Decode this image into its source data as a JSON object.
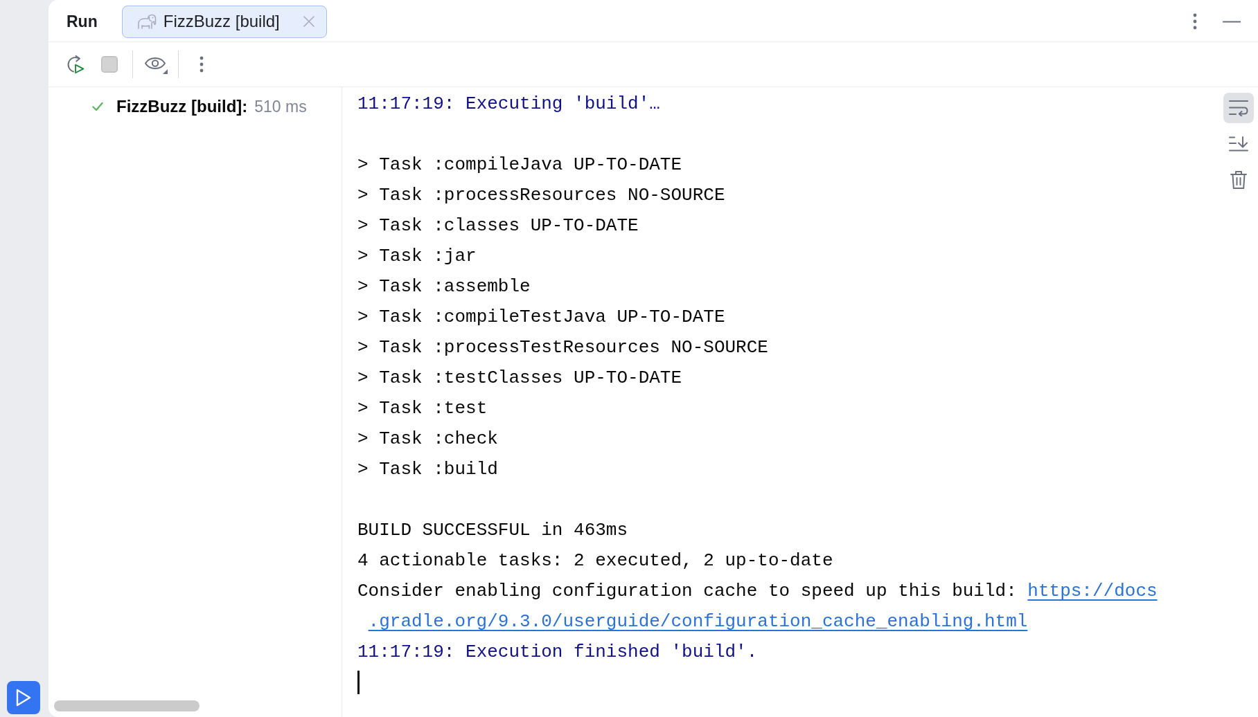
{
  "tool_window": {
    "title": "Run",
    "tabs": [
      {
        "label": "FizzBuzz [build]",
        "selected": true
      }
    ]
  },
  "toolbar": {
    "stop": {
      "disabled": true
    }
  },
  "tree": {
    "items": [
      {
        "kind": "success",
        "label": "FizzBuzz [build]:",
        "duration": "510 ms"
      }
    ]
  },
  "console": {
    "soft_wrap": {
      "on": true
    },
    "lines": [
      {
        "kind": "system",
        "text": "11:17:19: Executing 'build'…"
      },
      {
        "kind": "blank"
      },
      {
        "kind": "output",
        "text": "> Task :compileJava UP-TO-DATE"
      },
      {
        "kind": "output",
        "text": "> Task :processResources NO-SOURCE"
      },
      {
        "kind": "output",
        "text": "> Task :classes UP-TO-DATE"
      },
      {
        "kind": "output",
        "text": "> Task :jar"
      },
      {
        "kind": "output",
        "text": "> Task :assemble"
      },
      {
        "kind": "output",
        "text": "> Task :compileTestJava UP-TO-DATE"
      },
      {
        "kind": "output",
        "text": "> Task :processTestResources NO-SOURCE"
      },
      {
        "kind": "output",
        "text": "> Task :testClasses UP-TO-DATE"
      },
      {
        "kind": "output",
        "text": "> Task :test"
      },
      {
        "kind": "output",
        "text": "> Task :check"
      },
      {
        "kind": "output",
        "text": "> Task :build"
      },
      {
        "kind": "blank"
      },
      {
        "kind": "output",
        "text": "BUILD SUCCESSFUL in 463ms"
      },
      {
        "kind": "output",
        "text": "4 actionable tasks: 2 executed, 2 up-to-date"
      },
      {
        "kind": "link",
        "text": "Consider enabling configuration cache to speed up this build:",
        "link_parts": [
          "https://docs",
          ".gradle.org/9.3.0/userguide/configuration_cache_enabling.html"
        ]
      },
      {
        "kind": "system",
        "text": "11:17:19: Execution finished 'build'."
      }
    ]
  },
  "stripe": {
    "buttons": [
      {
        "kind": "run",
        "selected": true
      }
    ]
  }
}
